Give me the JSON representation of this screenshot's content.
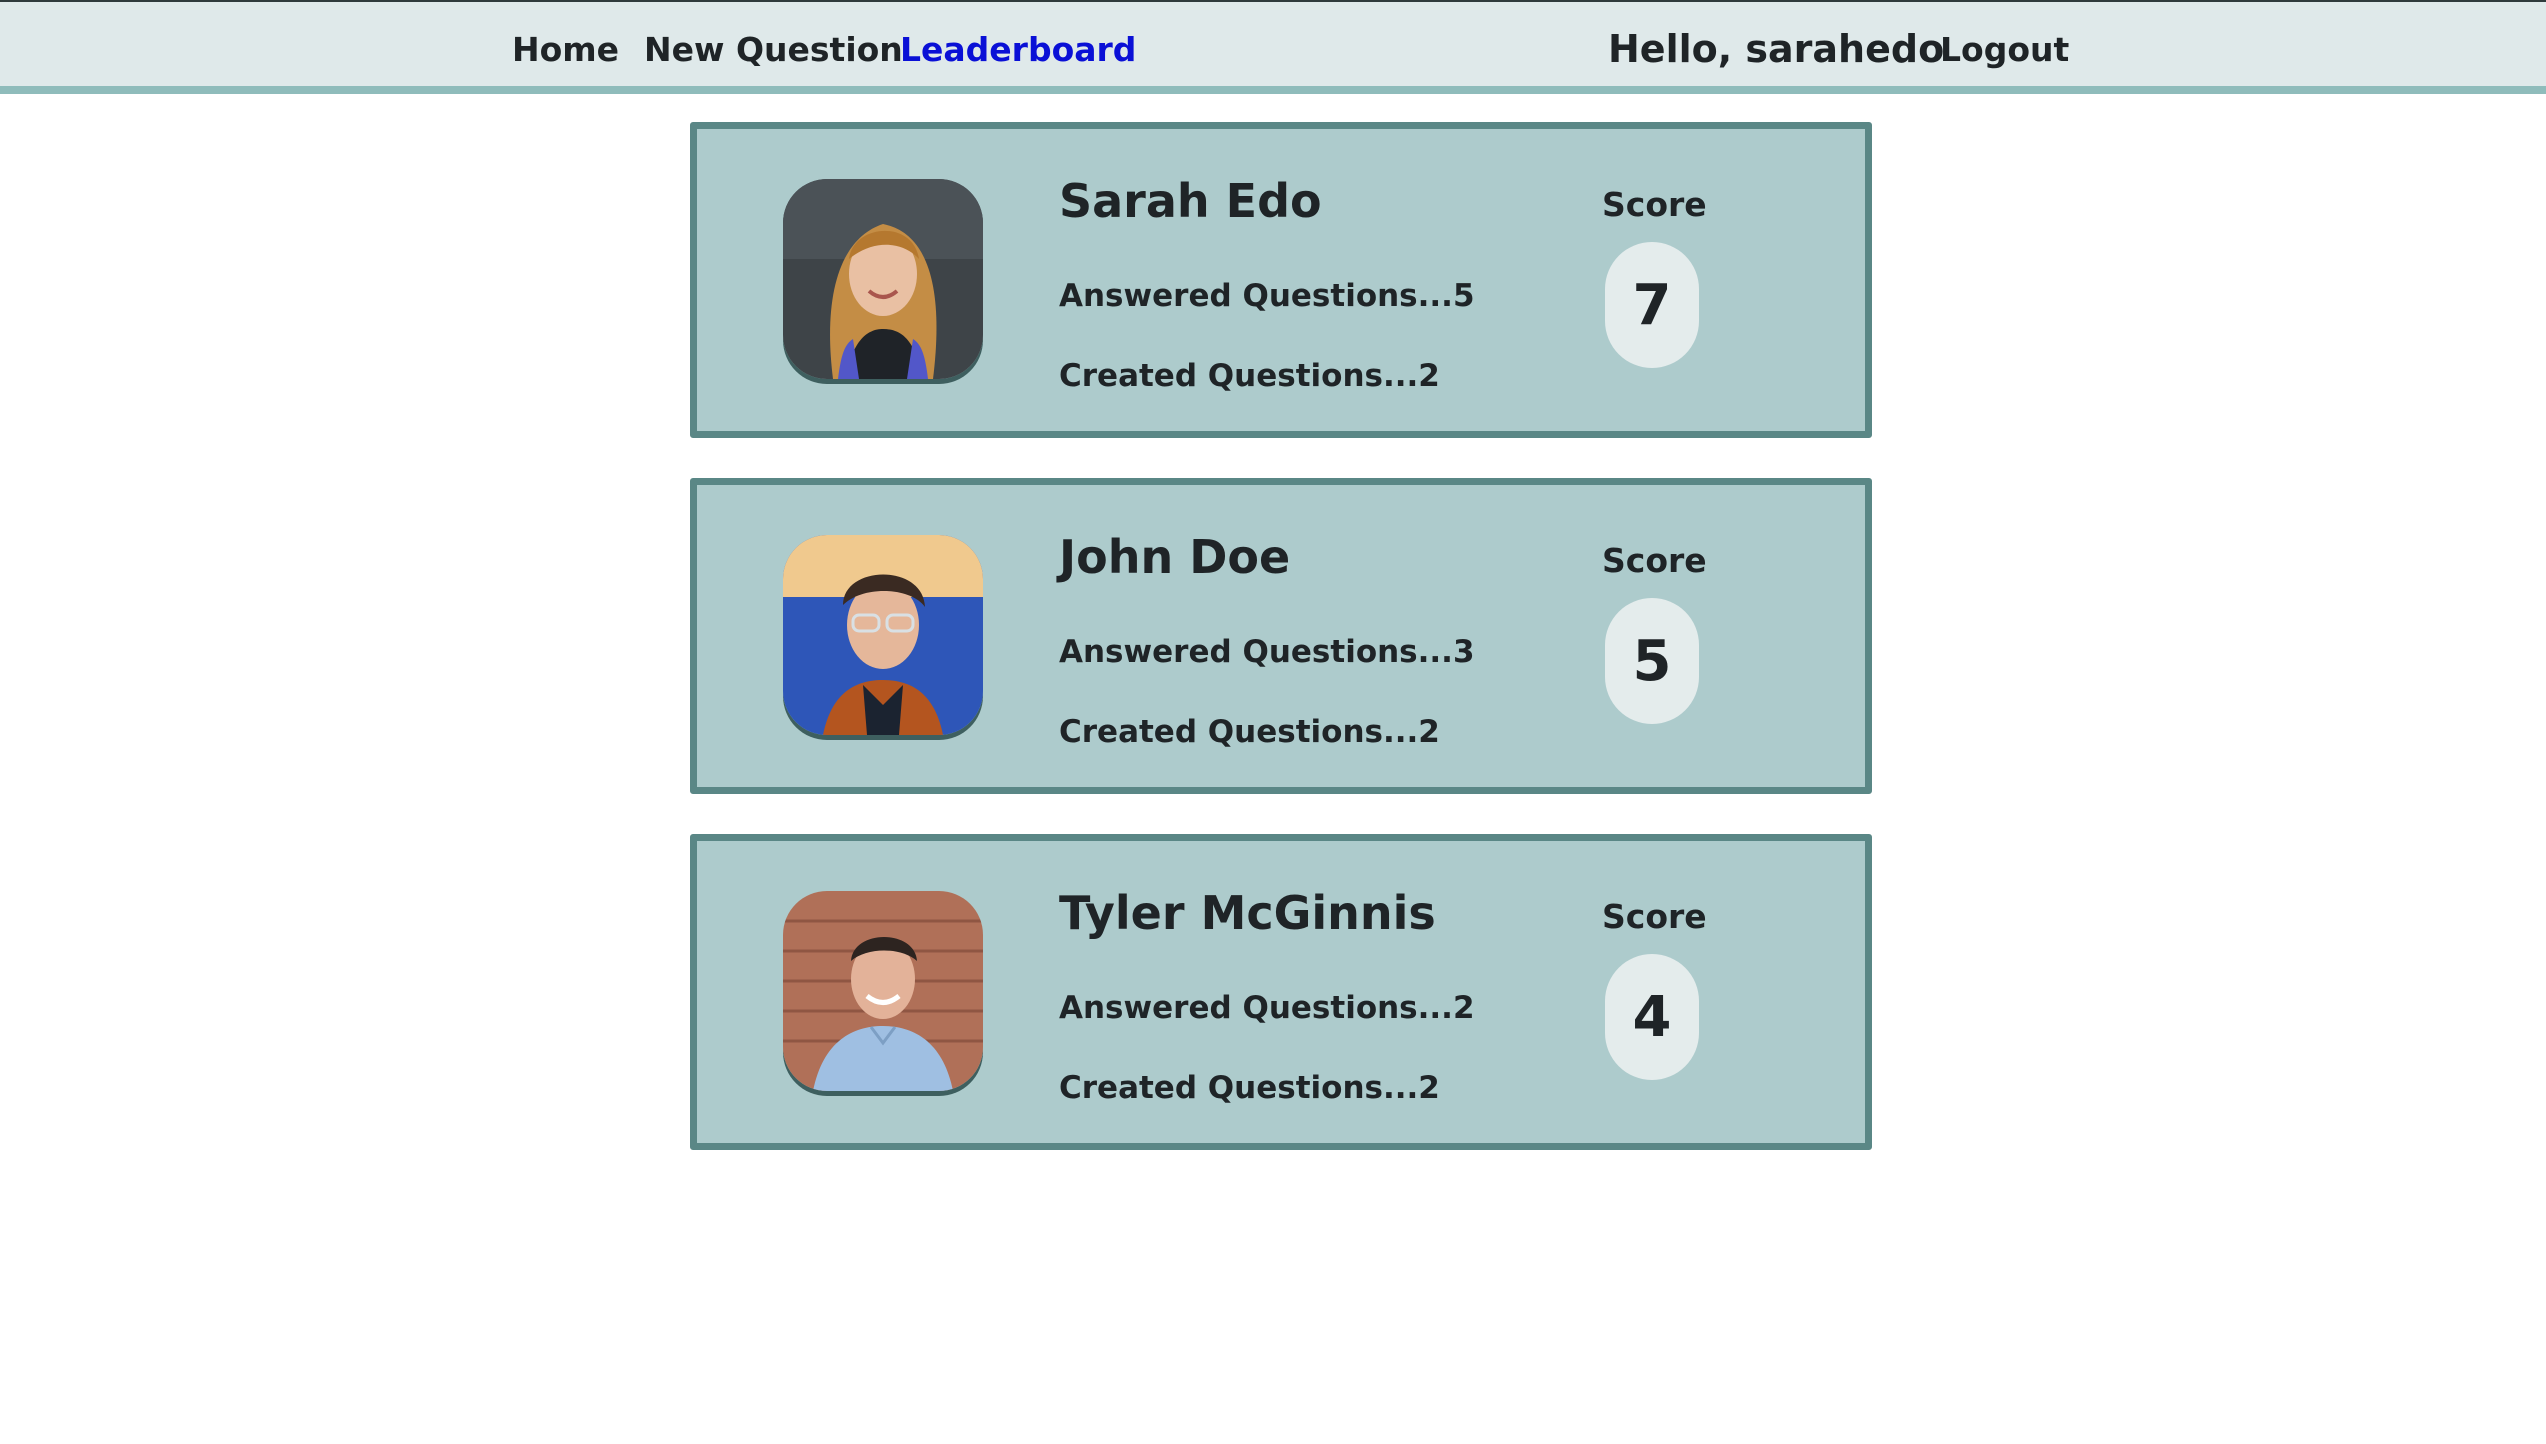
{
  "nav": {
    "home": "Home",
    "new_question": "New Question",
    "leaderboard": "Leaderboard",
    "greeting": "Hello, sarahedo",
    "logout": "Logout"
  },
  "colors": {
    "active_link": "#0a10d6",
    "card_background": "#adcbcc",
    "card_border": "#5a8786",
    "navbar_background": "#dfe9ea",
    "navbar_accent": "#8fbcbb"
  },
  "leaderboard": [
    {
      "name": "Sarah Edo",
      "answered": "Answered Questions...5",
      "created": "Created Questions...2",
      "score_label": "Score",
      "score": "7",
      "avatar": "avatar-photo"
    },
    {
      "name": "John Doe",
      "answered": "Answered Questions...3",
      "created": "Created Questions...2",
      "score_label": "Score",
      "score": "5",
      "avatar": "avatar-photo"
    },
    {
      "name": "Tyler McGinnis",
      "answered": "Answered Questions...2",
      "created": "Created Questions...2",
      "score_label": "Score",
      "score": "4",
      "avatar": "avatar-photo"
    }
  ]
}
